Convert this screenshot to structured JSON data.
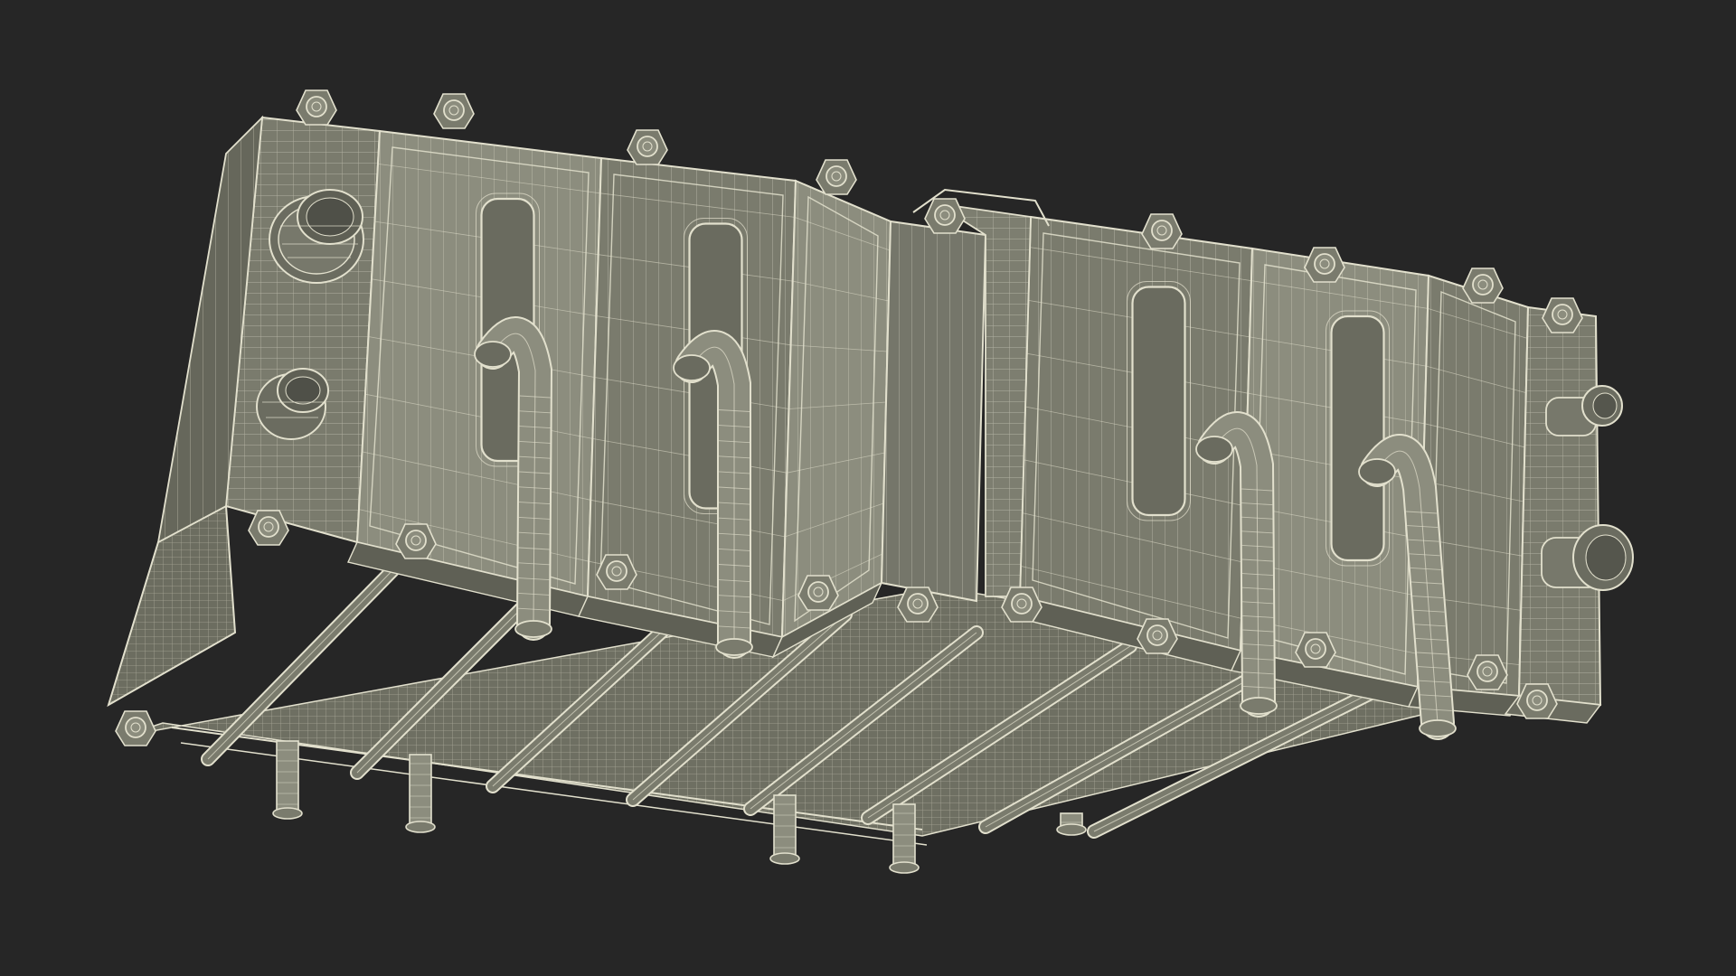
{
  "scene": {
    "subject": "",
    "colors": {
      "background": "#262626",
      "surface": "#7a7b6d",
      "surface_shadow": "#5f6055",
      "surface_light": "#8c8d7e",
      "wire": "#e2e0cd",
      "wire_faint": "#bdbba8",
      "opening": "#6a6b5f"
    },
    "counts": {
      "cooling_plates": 6,
      "bent_pipes": 4,
      "underside_rods": 8,
      "bottom_studs": 4,
      "side_ports": 4,
      "top_bolts": 9
    }
  }
}
